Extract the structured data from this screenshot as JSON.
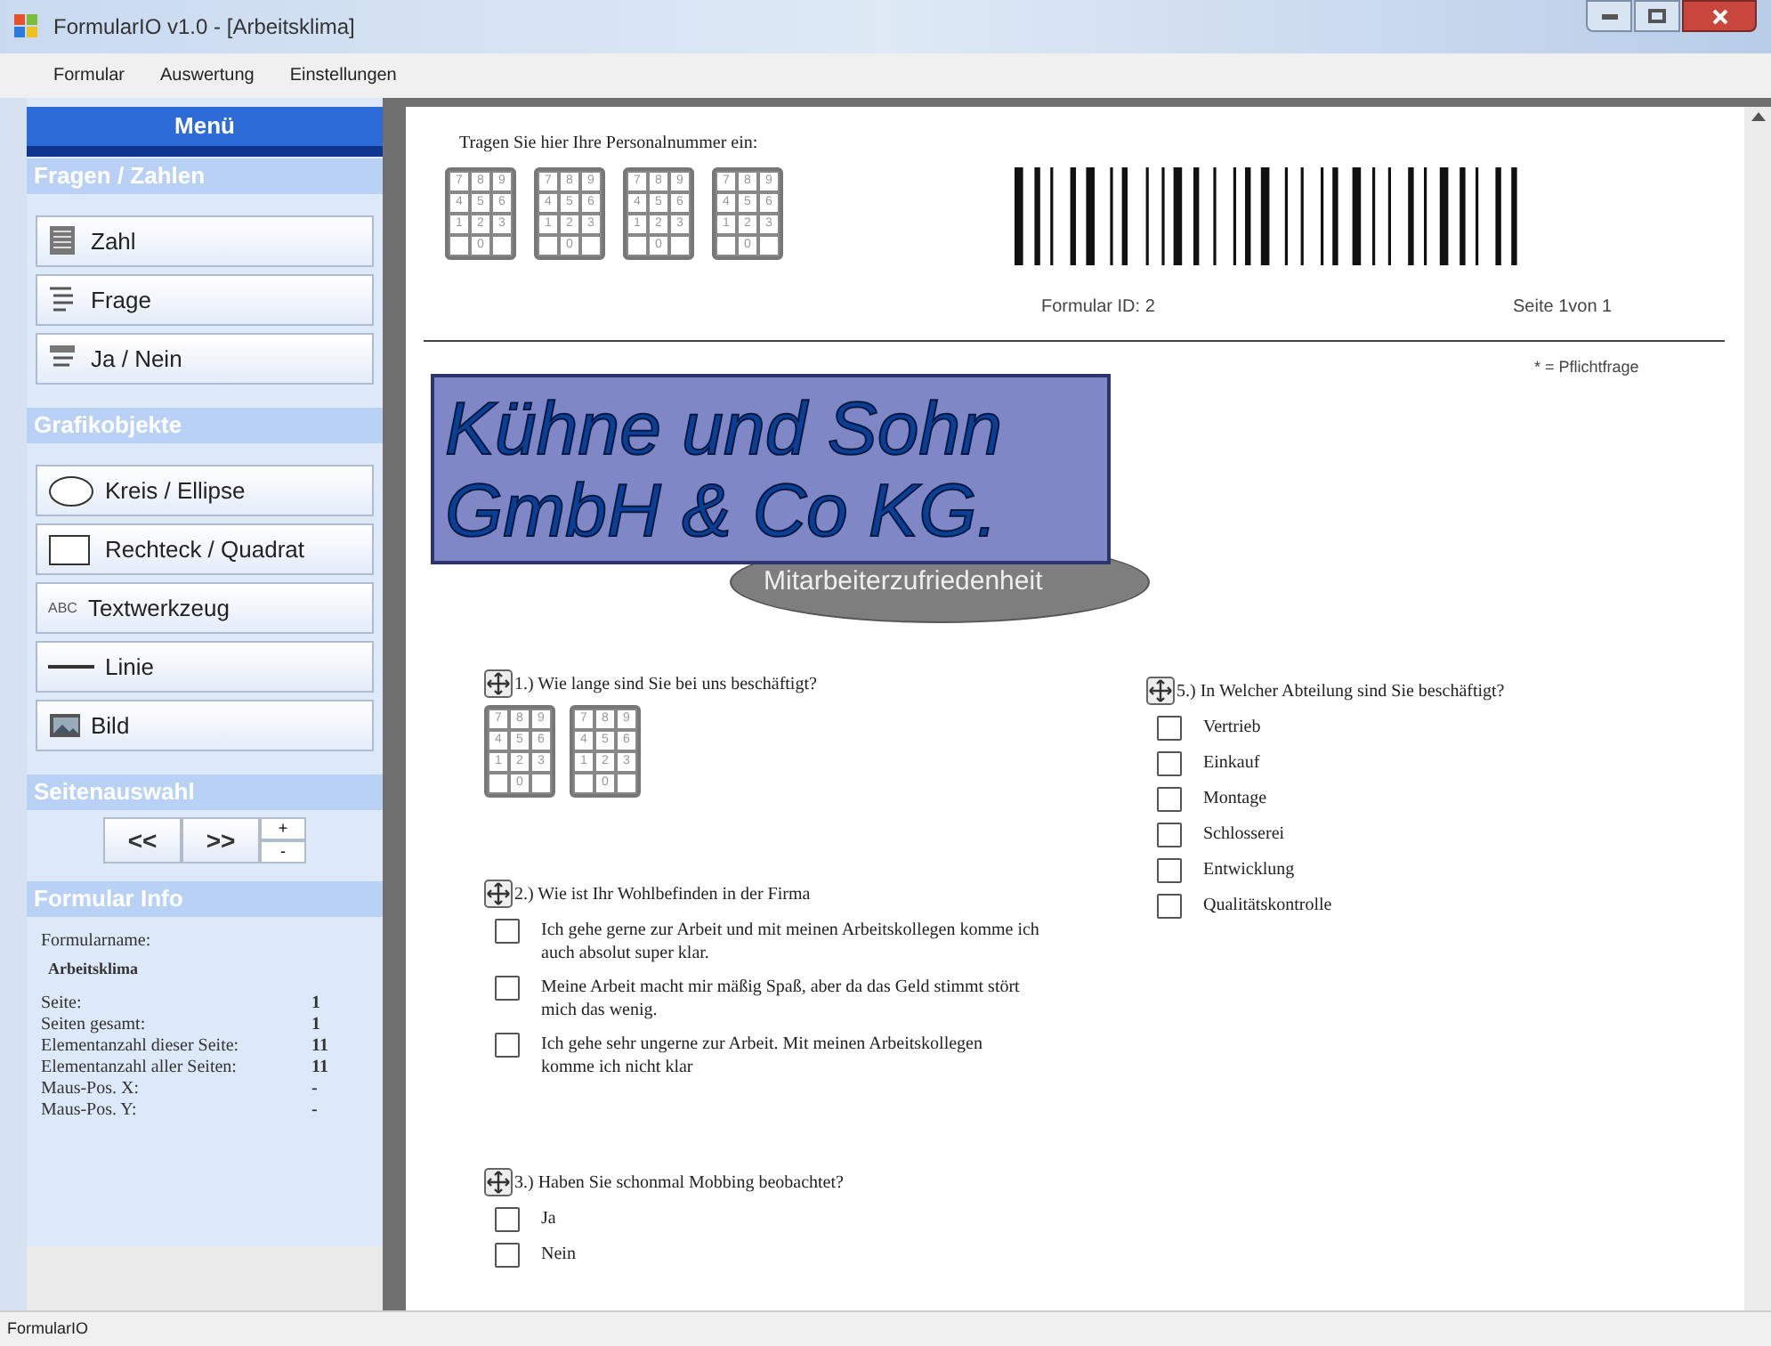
{
  "window": {
    "title": "FormularIO v1.0 - [Arbeitsklima]"
  },
  "menu": [
    "Formular",
    "Auswertung",
    "Einstellungen"
  ],
  "sidebar": {
    "title": "Menü",
    "sections": [
      {
        "title": "Fragen / Zahlen",
        "tools": [
          {
            "kind": "number",
            "label": "Zahl"
          },
          {
            "kind": "question",
            "label": "Frage"
          },
          {
            "kind": "yesno",
            "label": "Ja / Nein"
          }
        ]
      },
      {
        "title": "Grafikobjekte",
        "tools": [
          {
            "kind": "ellipse",
            "label": "Kreis / Ellipse"
          },
          {
            "kind": "rectangle",
            "label": "Rechteck / Quadrat"
          },
          {
            "kind": "text",
            "label": "Textwerkzeug",
            "icon_text": "ABC"
          },
          {
            "kind": "line",
            "label": "Linie"
          },
          {
            "kind": "image",
            "label": "Bild"
          }
        ]
      }
    ]
  },
  "page_nav": {
    "title": "Seitenauswahl",
    "prev": "<<",
    "next": ">>",
    "up": "+",
    "down": "-"
  },
  "info": {
    "title": "Formular Info",
    "name_label": "Formularname:",
    "name": "Arbeitsklima",
    "rows": [
      {
        "label": "Seite:",
        "value": "1"
      },
      {
        "label": "Seiten gesamt:",
        "value": "1"
      },
      {
        "label": "Elementanzahl dieser Seite:",
        "value": "11"
      },
      {
        "label": "Elementanzahl aller Seiten:",
        "value": "11"
      },
      {
        "label": "Maus-Pos. X:",
        "value": "-"
      },
      {
        "label": "Maus-Pos. Y:",
        "value": "-"
      }
    ]
  },
  "form": {
    "prompt": "Tragen Sie hier Ihre Personalnummer ein:",
    "id_keypads": [
      {
        "keys": [
          "7",
          "8",
          "9",
          "4",
          "5",
          "6",
          "1",
          "2",
          "3",
          "0"
        ]
      },
      {
        "keys": [
          "7",
          "8",
          "9",
          "4",
          "5",
          "6",
          "1",
          "2",
          "3",
          "0"
        ]
      },
      {
        "keys": [
          "7",
          "8",
          "9",
          "4",
          "5",
          "6",
          "1",
          "2",
          "3",
          "0"
        ]
      },
      {
        "keys": [
          "7",
          "8",
          "9",
          "4",
          "5",
          "6",
          "1",
          "2",
          "3",
          "0"
        ]
      }
    ],
    "form_id": "Formular ID: 2",
    "page": "Seite 1von 1",
    "required_note": "* = Pflichtfrage",
    "logo": {
      "lines": [
        "Kühne und Sohn",
        "GmbH & Co KG."
      ],
      "subtitle": "Mitarbeiterzufriedenheit"
    },
    "questions": [
      {
        "kind": "number",
        "text": "1.) Wie lange sind Sie bei uns beschäftigt?",
        "keypads": [
          {
            "keys": [
              "7",
              "8",
              "9",
              "4",
              "5",
              "6",
              "1",
              "2",
              "3",
              "0"
            ]
          },
          {
            "keys": [
              "7",
              "8",
              "9",
              "4",
              "5",
              "6",
              "1",
              "2",
              "3",
              "0"
            ]
          }
        ]
      },
      {
        "kind": "choice",
        "text": "2.) Wie ist Ihr Wohlbefinden in der Firma",
        "options": [
          {
            "label": "Ich gehe gerne zur Arbeit und mit meinen Arbeitskollegen komme ich auch absolut super klar.",
            "checked": false
          },
          {
            "label": "Meine Arbeit macht mir mäßig Spaß, aber da das Geld stimmt stört mich das wenig.",
            "checked": false
          },
          {
            "label": "Ich gehe sehr ungerne zur Arbeit. Mit meinen Arbeitskollegen komme ich nicht klar",
            "checked": false
          }
        ]
      },
      {
        "kind": "choice",
        "text": "3.) Haben Sie schonmal Mobbing beobachtet?",
        "options": [
          {
            "label": "Ja",
            "checked": false
          },
          {
            "label": "Nein",
            "checked": false
          }
        ]
      },
      {
        "kind": "choice",
        "text": "5.) In Welcher Abteilung sind Sie beschäftigt?",
        "options": [
          {
            "label": "Vertrieb",
            "checked": false
          },
          {
            "label": "Einkauf",
            "checked": false
          },
          {
            "label": "Montage",
            "checked": false
          },
          {
            "label": "Schlosserei",
            "checked": false
          },
          {
            "label": "Entwicklung",
            "checked": false
          },
          {
            "label": "Qualitätskontrolle",
            "checked": false
          }
        ]
      }
    ]
  },
  "status_bar": "FormularIO"
}
